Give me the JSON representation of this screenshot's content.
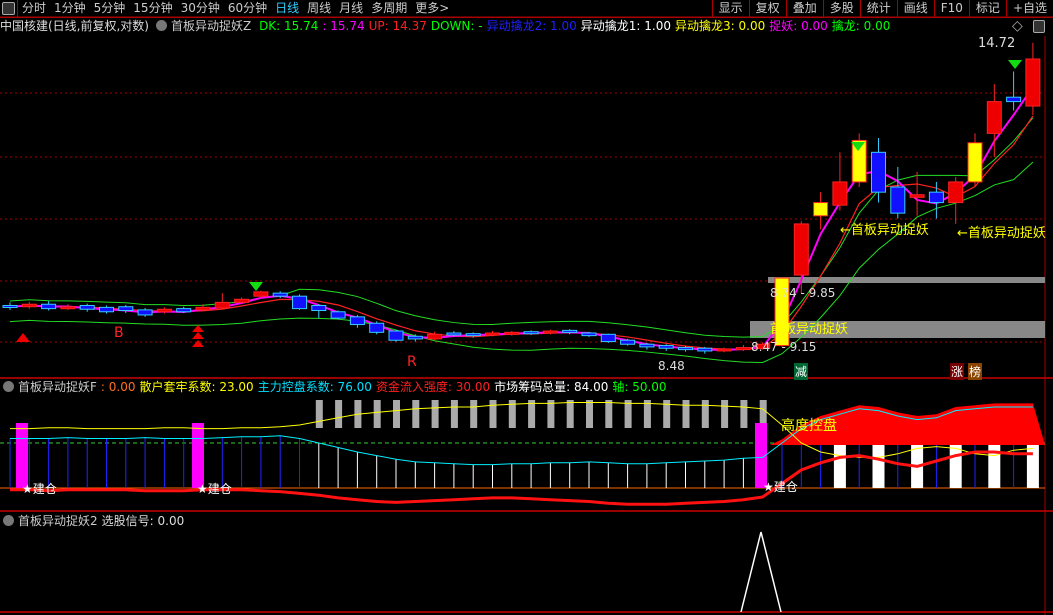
{
  "menu": {
    "periods": [
      "分时",
      "1分钟",
      "5分钟",
      "15分钟",
      "30分钟",
      "60分钟",
      "日线",
      "周线",
      "月线",
      "多周期",
      "更多>"
    ],
    "active": "日线",
    "tools": [
      "显示",
      "复权",
      "叠加",
      "多股",
      "统计",
      "画线",
      "F10",
      "标记",
      "+自选"
    ]
  },
  "main_legend": {
    "title": "中国核建(日线,前复权,对数)",
    "indicator": "首板异动捉妖Z",
    "items": [
      {
        "text": "DK: 15.74",
        "color": "#00ff00"
      },
      {
        "text": ": 15.74",
        "color": "#ff00ff"
      },
      {
        "text": "UP: 14.37",
        "color": "#ff2020"
      },
      {
        "text": "DOWN: -",
        "color": "#00ff00"
      },
      {
        "text": "异动擒龙2: 1.00",
        "color": "#2020ff"
      },
      {
        "text": "异动擒龙1: 1.00",
        "color": "#ffffff"
      },
      {
        "text": "异动擒龙3: 0.00",
        "color": "#ffff00"
      },
      {
        "text": "捉妖: 0.00",
        "color": "#ff00ff"
      },
      {
        "text": "擒龙: 0.00",
        "color": "#00ff00"
      }
    ]
  },
  "panel2_legend": {
    "indicator": "首板异动捉妖F",
    "items": [
      {
        "text": ": 0.00",
        "color": "#ff7020"
      },
      {
        "text": "散户套牢系数: 23.00",
        "color": "#ffff00"
      },
      {
        "text": "主力控盘系数: 76.00",
        "color": "#00e0ff"
      },
      {
        "text": "资金流入强度: 30.00",
        "color": "#ff2020"
      },
      {
        "text": "市场筹码总量: 84.00",
        "color": "#ffffff"
      },
      {
        "text": "轴: 50.00",
        "color": "#00ff00"
      }
    ]
  },
  "panel3_legend": {
    "indicator": "首板异动捉妖2",
    "value": "选股信号: 0.00"
  },
  "annotations": {
    "high": "14.72",
    "low": "8.48",
    "zone_upper": "8.74 - 9.85",
    "zone_lower": "8.47 - 9.15",
    "signal": "首板异动捉妖",
    "signal2": "←首板异动捉妖",
    "signal3": "←首板异动捉妖",
    "b": "B",
    "r": "R",
    "jian": "减",
    "zhang": "涨",
    "bang": "榜",
    "high_control": "高度控盘",
    "build": "建仓"
  },
  "chart_data": {
    "type": "candlestick",
    "scale": "log",
    "price_range": [
      8.48,
      14.72
    ],
    "candles": [
      [
        9.4,
        9.38,
        9.45,
        9.33
      ],
      [
        9.38,
        9.42,
        9.46,
        9.35
      ],
      [
        9.42,
        9.35,
        9.47,
        9.32
      ],
      [
        9.36,
        9.38,
        9.42,
        9.33
      ],
      [
        9.4,
        9.34,
        9.43,
        9.3
      ],
      [
        9.37,
        9.3,
        9.4,
        9.27
      ],
      [
        9.38,
        9.32,
        9.41,
        9.28
      ],
      [
        9.33,
        9.25,
        9.36,
        9.22
      ],
      [
        9.3,
        9.34,
        9.37,
        9.27
      ],
      [
        9.35,
        9.3,
        9.38,
        9.28
      ],
      [
        9.33,
        9.37,
        9.42,
        9.31
      ],
      [
        9.36,
        9.45,
        9.6,
        9.34
      ],
      [
        9.45,
        9.5,
        9.53,
        9.43
      ],
      [
        9.55,
        9.62,
        9.64,
        9.52
      ],
      [
        9.6,
        9.55,
        9.63,
        9.52
      ],
      [
        9.55,
        9.35,
        9.58,
        9.33
      ],
      [
        9.4,
        9.32,
        9.42,
        9.2
      ],
      [
        9.3,
        9.2,
        9.32,
        9.18
      ],
      [
        9.22,
        9.1,
        9.25,
        9.05
      ],
      [
        9.12,
        8.98,
        9.15,
        8.95
      ],
      [
        9.0,
        8.86,
        9.02,
        8.84
      ],
      [
        8.92,
        8.88,
        8.95,
        8.84
      ],
      [
        8.88,
        8.95,
        8.99,
        8.86
      ],
      [
        8.97,
        8.94,
        9.0,
        8.92
      ],
      [
        8.96,
        8.93,
        8.98,
        8.9
      ],
      [
        8.94,
        8.97,
        9.0,
        8.92
      ],
      [
        8.95,
        8.98,
        9.0,
        8.93
      ],
      [
        8.99,
        8.96,
        9.01,
        8.94
      ],
      [
        8.97,
        9.0,
        9.02,
        8.95
      ],
      [
        9.01,
        8.98,
        9.03,
        8.95
      ],
      [
        8.97,
        8.93,
        8.99,
        8.91
      ],
      [
        8.95,
        8.84,
        8.96,
        8.82
      ],
      [
        8.86,
        8.8,
        8.88,
        8.78
      ],
      [
        8.8,
        8.76,
        8.82,
        8.72
      ],
      [
        8.78,
        8.74,
        8.8,
        8.7
      ],
      [
        8.75,
        8.72,
        8.78,
        8.69
      ],
      [
        8.74,
        8.7,
        8.76,
        8.66
      ],
      [
        8.71,
        8.73,
        8.75,
        8.68
      ],
      [
        8.72,
        8.75,
        8.79,
        8.7
      ],
      [
        8.74,
        8.8,
        8.83,
        8.72
      ],
      [
        8.78,
        9.85,
        9.85,
        8.76
      ],
      [
        9.9,
        10.8,
        10.85,
        9.6
      ],
      [
        10.95,
        11.2,
        11.4,
        10.7
      ],
      [
        11.15,
        11.6,
        12.2,
        11.05
      ],
      [
        11.6,
        12.45,
        12.6,
        11.5
      ],
      [
        12.2,
        11.4,
        12.5,
        11.2
      ],
      [
        11.5,
        11.0,
        11.9,
        10.9
      ],
      [
        11.3,
        11.35,
        11.8,
        10.95
      ],
      [
        11.4,
        11.2,
        11.6,
        10.9
      ],
      [
        11.2,
        11.6,
        11.7,
        10.8
      ],
      [
        11.6,
        12.4,
        12.6,
        11.5
      ],
      [
        12.6,
        13.3,
        13.7,
        12.1
      ],
      [
        13.4,
        13.3,
        14.0,
        13.1
      ],
      [
        13.2,
        14.3,
        14.7,
        13.0
      ]
    ],
    "panel2": {
      "range": [
        0,
        100
      ],
      "yellow": [
        66,
        66,
        67,
        67,
        66,
        66,
        66,
        66,
        67,
        67,
        66,
        66,
        67,
        67,
        68,
        70,
        74,
        78,
        82,
        84,
        86,
        88,
        89,
        90,
        90,
        92,
        93,
        94,
        94,
        95,
        95,
        95,
        94,
        94,
        93,
        92,
        92,
        91,
        90,
        88,
        70,
        50,
        40,
        36,
        34,
        34,
        38,
        44,
        46,
        44,
        38,
        36,
        42,
        44
      ],
      "cyan": [
        55,
        55,
        55,
        56,
        55,
        55,
        55,
        56,
        55,
        55,
        55,
        56,
        57,
        57,
        58,
        55,
        50,
        45,
        40,
        36,
        32,
        29,
        28,
        27,
        26,
        26,
        27,
        27,
        28,
        28,
        29,
        28,
        27,
        27,
        28,
        29,
        30,
        31,
        33,
        34,
        50,
        66,
        76,
        82,
        88,
        86,
        80,
        76,
        78,
        86,
        88,
        90,
        90,
        90
      ],
      "red": [
        -2,
        -2,
        -3,
        -2,
        -2,
        -2,
        -2,
        -3,
        -3,
        -3,
        -2,
        -2,
        -2,
        -3,
        -4,
        -6,
        -8,
        -11,
        -13,
        -15,
        -16,
        -15,
        -14,
        -13,
        -12,
        -11,
        -11,
        -12,
        -13,
        -14,
        -15,
        -17,
        -18,
        -18,
        -18,
        -17,
        -16,
        -15,
        -13,
        -10,
        5,
        20,
        28,
        34,
        36,
        32,
        27,
        24,
        30,
        36,
        40,
        40,
        38,
        38
      ]
    }
  }
}
